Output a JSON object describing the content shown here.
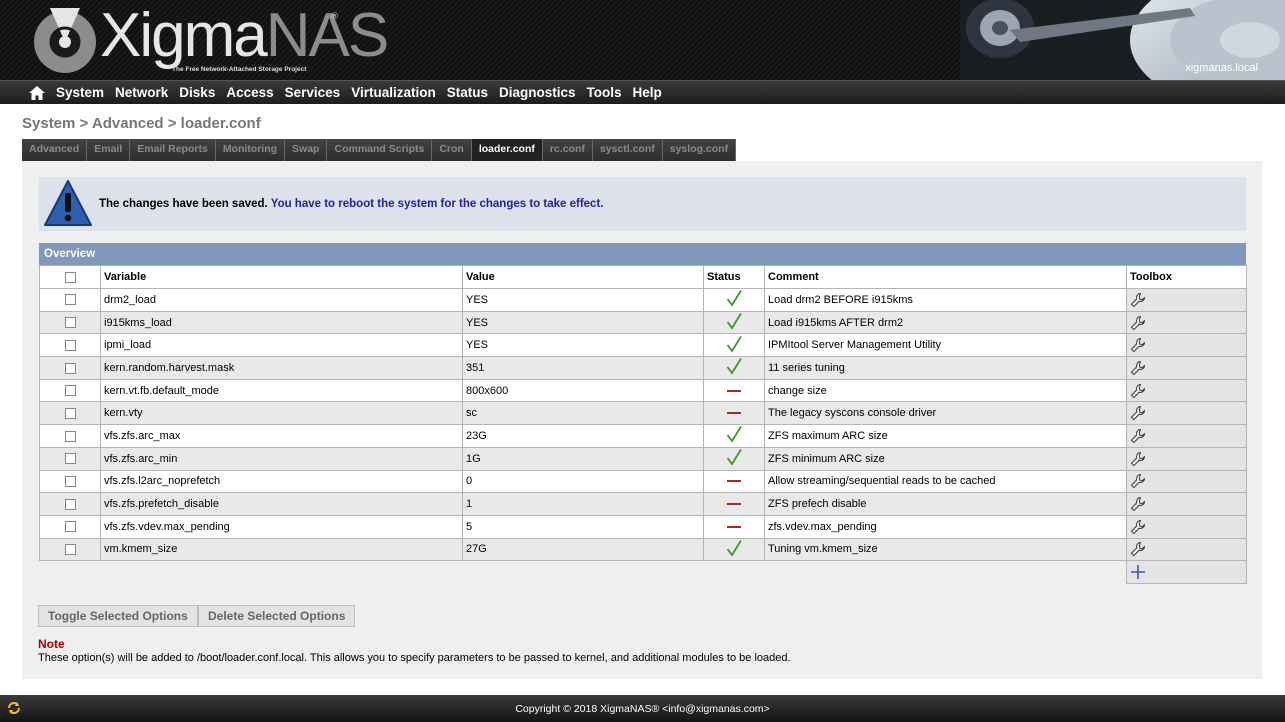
{
  "header": {
    "logo_main": "Xigma",
    "logo_accent": "NAS",
    "logo_reg": "®",
    "tagline": "The Free Network-Attached Storage Project",
    "hostname": "xigmanas.local"
  },
  "nav": {
    "home_icon": "home-icon",
    "items": [
      "System",
      "Network",
      "Disks",
      "Access",
      "Services",
      "Virtualization",
      "Status",
      "Diagnostics",
      "Tools",
      "Help"
    ]
  },
  "breadcrumb": "System > Advanced > loader.conf",
  "tabs": [
    {
      "label": "Advanced",
      "active": false
    },
    {
      "label": "Email",
      "active": false
    },
    {
      "label": "Email Reports",
      "active": false
    },
    {
      "label": "Monitoring",
      "active": false
    },
    {
      "label": "Swap",
      "active": false
    },
    {
      "label": "Command Scripts",
      "active": false
    },
    {
      "label": "Cron",
      "active": false
    },
    {
      "label": "loader.conf",
      "active": true
    },
    {
      "label": "rc.conf",
      "active": false
    },
    {
      "label": "sysctl.conf",
      "active": false
    },
    {
      "label": "syslog.conf",
      "active": false
    }
  ],
  "message": {
    "icon": "warning-icon",
    "text": "The changes have been saved.",
    "highlight": "You have to reboot the system for the changes to take effect."
  },
  "overview": {
    "title": "Overview",
    "columns": {
      "variable": "Variable",
      "value": "Value",
      "status": "Status",
      "comment": "Comment",
      "toolbox": "Toolbox"
    },
    "rows": [
      {
        "variable": "drm2_load",
        "value": "YES",
        "enabled": true,
        "comment": "Load drm2 BEFORE i915kms"
      },
      {
        "variable": "i915kms_load",
        "value": "YES",
        "enabled": true,
        "comment": "Load i915kms AFTER drm2"
      },
      {
        "variable": "ipmi_load",
        "value": "YES",
        "enabled": true,
        "comment": "IPMItool Server Management Utility"
      },
      {
        "variable": "kern.random.harvest.mask",
        "value": "351",
        "enabled": true,
        "comment": "11 series tuning"
      },
      {
        "variable": "kern.vt.fb.default_mode",
        "value": "800x600",
        "enabled": false,
        "comment": "change size"
      },
      {
        "variable": "kern.vty",
        "value": "sc",
        "enabled": false,
        "comment": "The legacy syscons console driver"
      },
      {
        "variable": "vfs.zfs.arc_max",
        "value": "23G",
        "enabled": true,
        "comment": "ZFS maximum ARC size"
      },
      {
        "variable": "vfs.zfs.arc_min",
        "value": "1G",
        "enabled": true,
        "comment": "ZFS minimum ARC size"
      },
      {
        "variable": "vfs.zfs.l2arc_noprefetch",
        "value": "0",
        "enabled": false,
        "comment": "Allow streaming/sequential reads to be cached"
      },
      {
        "variable": "vfs.zfs.prefetch_disable",
        "value": "1",
        "enabled": false,
        "comment": "ZFS prefech disable"
      },
      {
        "variable": "vfs.zfs.vdev.max_pending",
        "value": "5",
        "enabled": false,
        "comment": "zfs.vdev.max_pending"
      },
      {
        "variable": "vm.kmem_size",
        "value": "27G",
        "enabled": true,
        "comment": "Tuning vm.kmem_size"
      }
    ]
  },
  "buttons": {
    "toggle": "Toggle Selected Options",
    "delete": "Delete Selected Options"
  },
  "note": {
    "title": "Note",
    "text": "These option(s) will be added to /boot/loader.conf.local. This allows you to specify parameters to be passed to kernel, and additional modules to be loaded."
  },
  "footer": {
    "copyright": "Copyright © 2018 XigmaNAS® <info@xigmanas.com>"
  },
  "colors": {
    "ok": "#3a9a2a",
    "disabled": "#b22222",
    "overview_bar": "#7f98bb",
    "note": "#b00000"
  }
}
